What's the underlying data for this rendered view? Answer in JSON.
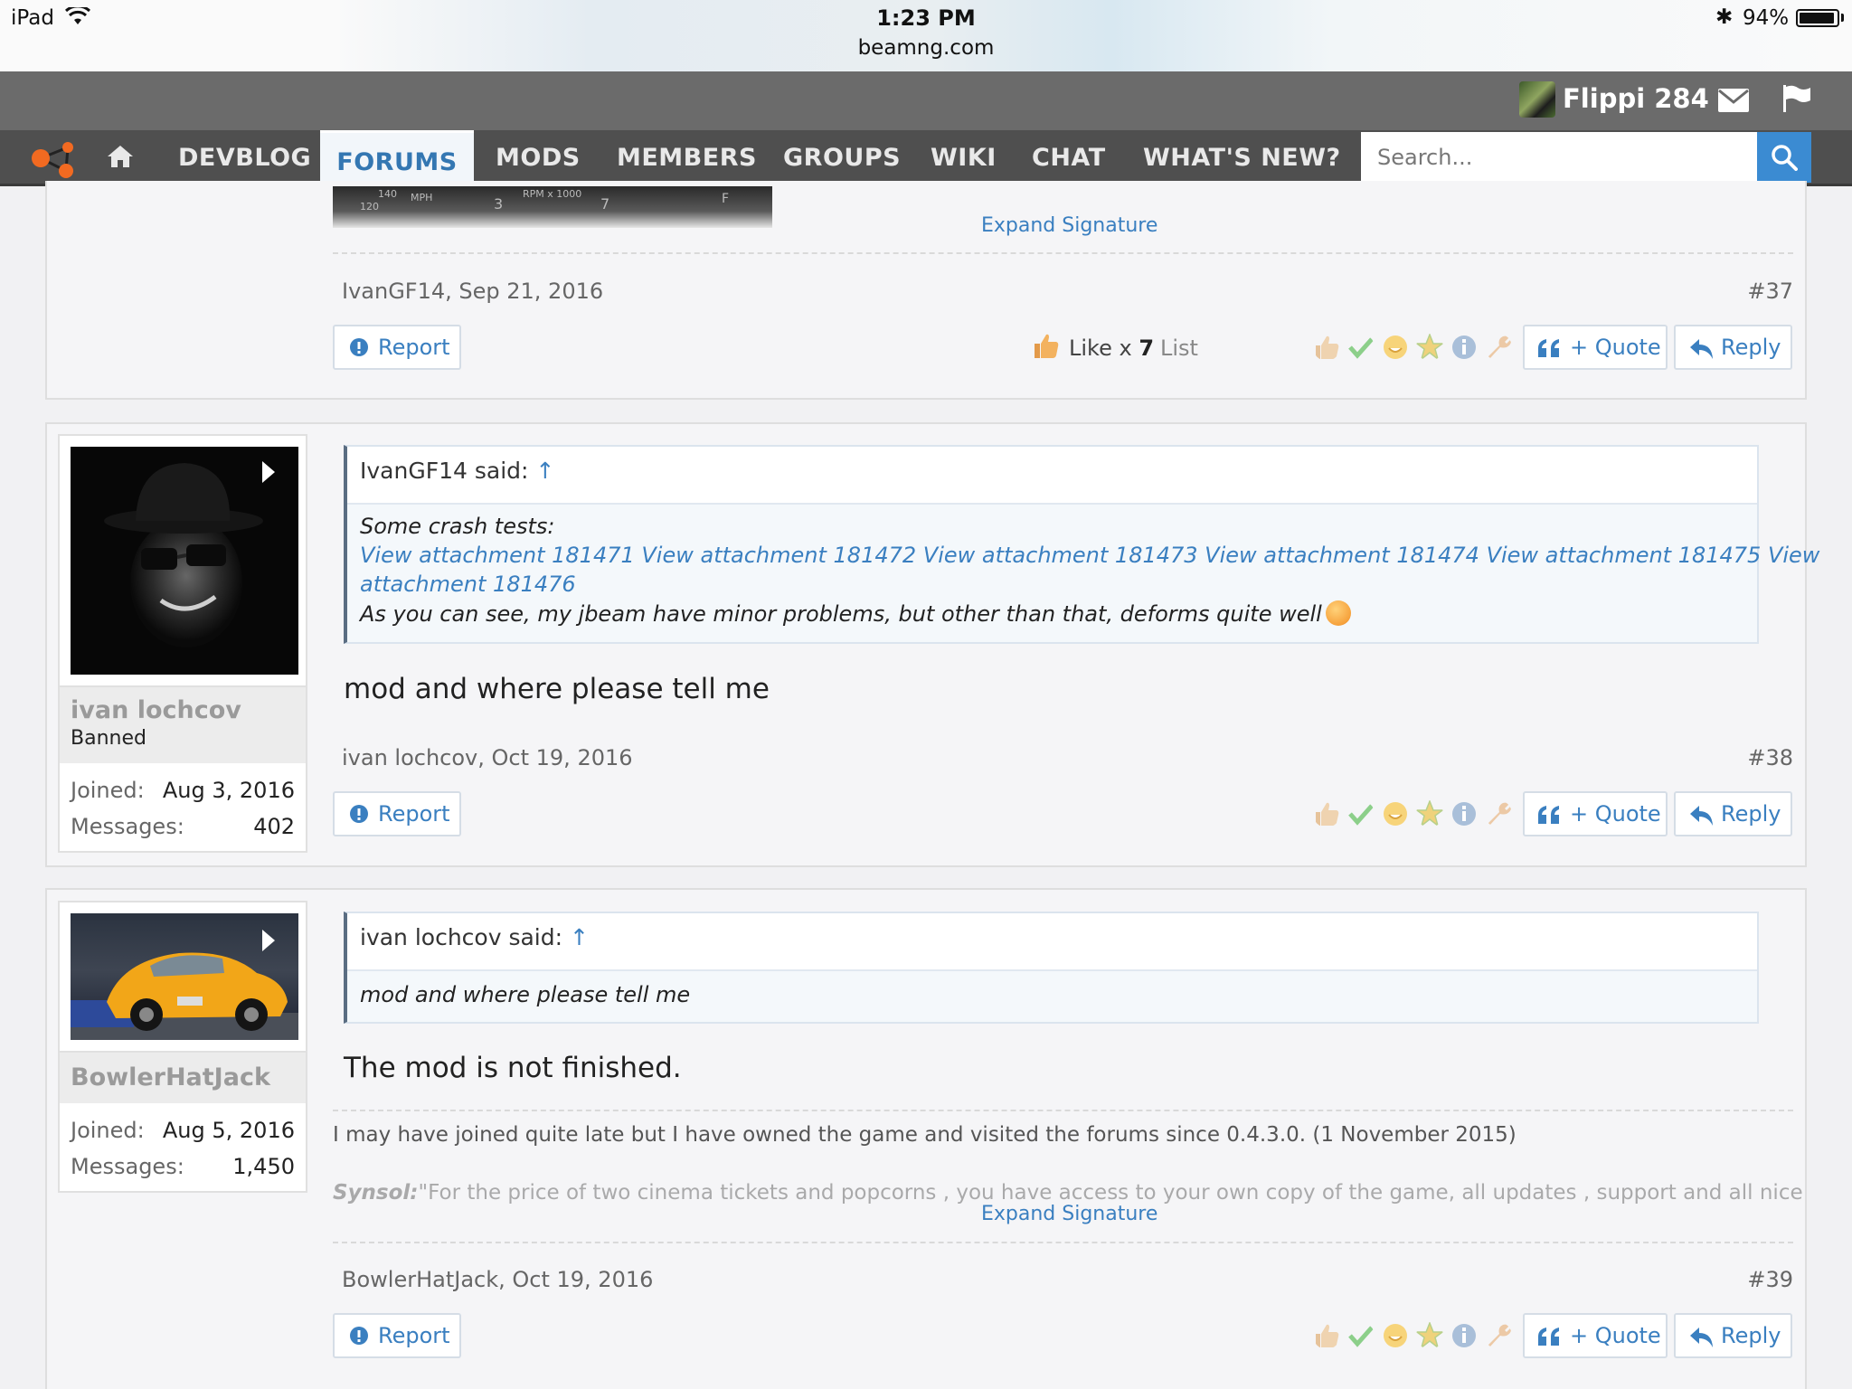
{
  "status_bar": {
    "device": "iPad",
    "time": "1:23 PM",
    "url": "beamng.com",
    "battery_text": "94%",
    "battery_level": 0.94
  },
  "user_bar": {
    "username": "Flippi 284",
    "avatar_icon": "user-avatar",
    "mail_icon": "envelope-icon",
    "flag_icon": "flag-icon"
  },
  "nav": {
    "home_icon": "home-icon",
    "items": [
      {
        "label": "DEVBLOG",
        "active": false
      },
      {
        "label": "FORUMS",
        "active": true
      },
      {
        "label": "MODS",
        "active": false
      },
      {
        "label": "MEMBERS",
        "active": false
      },
      {
        "label": "GROUPS",
        "active": false
      },
      {
        "label": "WIKI",
        "active": false
      },
      {
        "label": "CHAT",
        "active": false
      },
      {
        "label": "WHAT'S NEW?",
        "active": false
      }
    ],
    "search_placeholder": "Search..."
  },
  "colors": {
    "accent": "#3a7fc0",
    "nav_bg": "#4f4f4f",
    "user_bar_bg": "#6b6b6b",
    "search_button": "#3b8bd2"
  },
  "post37": {
    "sig_gauge": {
      "mph": "MPH",
      "v140": "140",
      "v120": "120",
      "rpm": "RPM x 1000",
      "r3": "3",
      "r7": "7",
      "f": "F"
    },
    "expand_signature": "Expand Signature",
    "meta": "IvanGF14, Sep 21, 2016",
    "number": "#37",
    "report": "Report",
    "like_summary_prefix": "Like x ",
    "like_count": "7",
    "like_list": "List",
    "quote": "+ Quote",
    "reply": "Reply"
  },
  "post38": {
    "username": "ivan lochcov",
    "user_title": "Banned",
    "joined_label": "Joined:",
    "joined": "Aug 3, 2016",
    "messages_label": "Messages:",
    "messages": "402",
    "quote_author": "IvanGF14 said:",
    "quote_arrow": "↑",
    "quote_line1": "Some crash tests:",
    "quote_links1": "View attachment 181471 View attachment 181472 View attachment 181473 View attachment 181474 View attachment 181475 View",
    "quote_links2": "attachment 181476",
    "quote_line3": "As you can see, my jbeam have minor problems, but other than that, deforms quite well",
    "text": "mod and where please tell me",
    "meta": "ivan lochcov, Oct 19, 2016",
    "number": "#38",
    "report": "Report",
    "quote": "+ Quote",
    "reply": "Reply"
  },
  "post39": {
    "username": "BowlerHatJack",
    "joined_label": "Joined:",
    "joined": "Aug 5, 2016",
    "messages_label": "Messages:",
    "messages": "1,450",
    "quote_author": "ivan lochcov said:",
    "quote_arrow": "↑",
    "quote_line1": "mod and where please tell me",
    "text": "The mod is not finished.",
    "signature_line1": "I may have joined quite late but I have owned the game and visited the forums since 0.4.3.0. (1 November 2015)",
    "signature_label": "Synsol:",
    "signature_line2": "\"For the price of two cinema tickets and popcorns , you have access to your own copy of the game, all updates , support and all nice",
    "expand_signature": "Expand Signature",
    "meta": "BowlerHatJack, Oct 19, 2016",
    "number": "#39",
    "report": "Report",
    "quote": "+ Quote",
    "reply": "Reply"
  },
  "reaction_icons": [
    "thumbs-up-icon",
    "check-icon",
    "grin-icon",
    "star-icon",
    "info-icon",
    "wrench-icon"
  ]
}
